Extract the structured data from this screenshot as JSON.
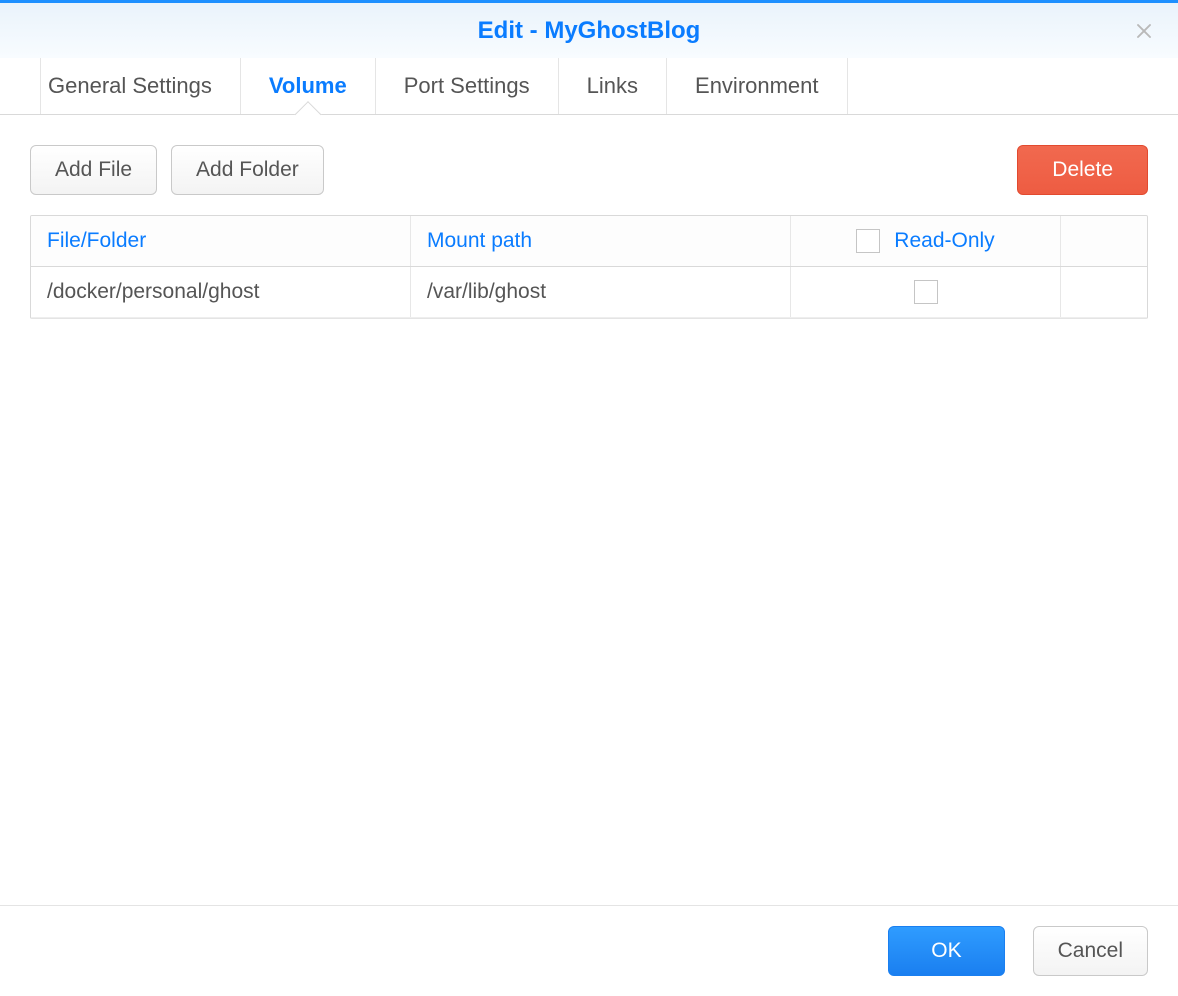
{
  "window": {
    "title": "Edit - MyGhostBlog"
  },
  "tabs": {
    "general": "General Settings",
    "volume": "Volume",
    "port": "Port Settings",
    "links": "Links",
    "environment": "Environment",
    "active": "volume"
  },
  "toolbar": {
    "add_file": "Add File",
    "add_folder": "Add Folder",
    "delete": "Delete"
  },
  "table": {
    "headers": {
      "file_folder": "File/Folder",
      "mount_path": "Mount path",
      "read_only": "Read-Only"
    },
    "rows": [
      {
        "file_folder": "/docker/personal/ghost",
        "mount_path": "/var/lib/ghost",
        "read_only": false
      }
    ]
  },
  "footer": {
    "ok": "OK",
    "cancel": "Cancel"
  }
}
